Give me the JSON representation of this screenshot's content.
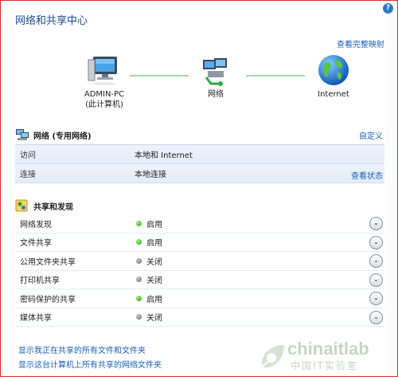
{
  "header": {
    "title": "网络和共享中心",
    "help": "?",
    "view_full_map": "查看完整映射"
  },
  "map": {
    "pc_name": "ADMIN-PC",
    "pc_sub": "(此计算机)",
    "network_label": "网络",
    "internet_label": "Internet"
  },
  "network_section": {
    "title": "网络 (专用网络)",
    "customize": "自定义",
    "rows": [
      {
        "key": "访问",
        "value": "本地和 Internet"
      },
      {
        "key": "连接",
        "value": "本地连接",
        "link": "查看状态"
      }
    ]
  },
  "sharing_section": {
    "title": "共享和发现",
    "rows": [
      {
        "key": "网络发现",
        "status": "启用",
        "on": true
      },
      {
        "key": "文件共享",
        "status": "启用",
        "on": true
      },
      {
        "key": "公用文件夹共享",
        "status": "关闭",
        "on": false
      },
      {
        "key": "打印机共享",
        "status": "关闭",
        "on": false
      },
      {
        "key": "密码保护的共享",
        "status": "启用",
        "on": true
      },
      {
        "key": "媒体共享",
        "status": "关闭",
        "on": false
      }
    ]
  },
  "links": {
    "show_shared_files": "显示我正在共享的所有文件和文件夹",
    "show_shared_folders": "显示这台计算机上所有共享的网络文件夹"
  },
  "watermark": {
    "brand": "chinaitlab",
    "sub": "中国IT实验室"
  },
  "colors": {
    "accent": "#1a5fb4",
    "status_on": "#2e9b16",
    "status_off": "#6d6d6d",
    "border": "#d32f2f"
  }
}
